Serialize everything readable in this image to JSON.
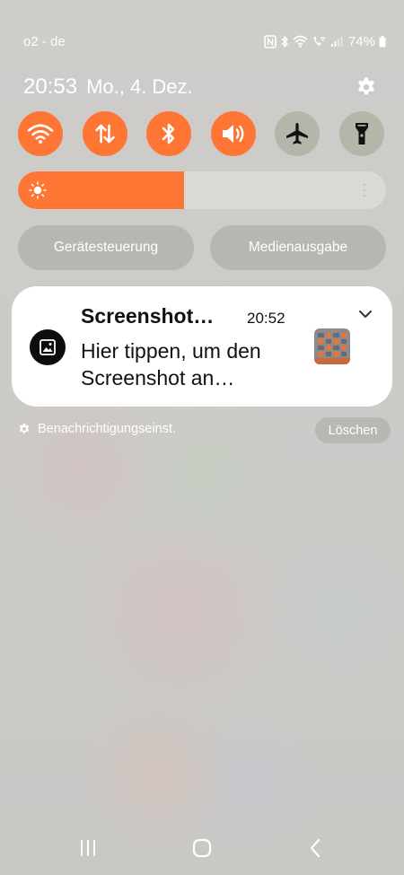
{
  "status_bar": {
    "carrier": "o2 - de",
    "battery": "74%",
    "icons": [
      "nfc-icon",
      "bluetooth-icon",
      "wifi-icon",
      "wifi-calling-icon",
      "signal-icon",
      "battery-icon"
    ]
  },
  "header": {
    "time": "20:53",
    "date": "Mo., 4. Dez.",
    "settings_icon": "gear-icon"
  },
  "quick_tiles": [
    {
      "icon": "wifi-icon",
      "state": "on"
    },
    {
      "icon": "mobile-data-icon",
      "state": "on"
    },
    {
      "icon": "bluetooth-icon",
      "state": "on"
    },
    {
      "icon": "sound-icon",
      "state": "on"
    },
    {
      "icon": "airplane-icon",
      "state": "off"
    },
    {
      "icon": "flashlight-icon",
      "state": "off"
    }
  ],
  "brightness": {
    "level_percent": 45
  },
  "buttons": {
    "device_control": "Gerätesteuerung",
    "media_output": "Medienausgabe"
  },
  "notification": {
    "title": "Screenshot…",
    "time": "20:52",
    "body": "Hier tippen, um den Screenshot an…",
    "app_icon": "image-icon"
  },
  "notification_settings": "Benachrichtigungseinst.",
  "clear_label": "Löschen",
  "colors": {
    "accent": "#ff7534",
    "tile_off": "#b5b6a9",
    "card_bg": "#ffffff"
  },
  "nav": [
    "recents-icon",
    "home-icon",
    "back-icon"
  ]
}
